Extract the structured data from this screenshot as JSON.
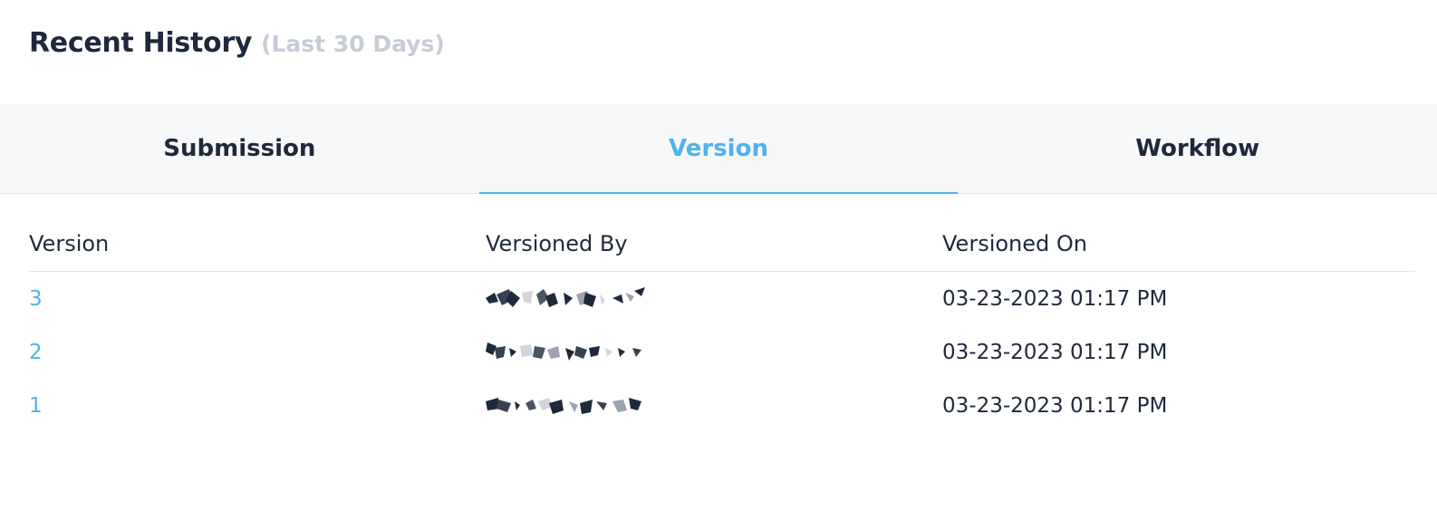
{
  "header": {
    "title": "Recent History",
    "subtitle": "(Last 30 Days)"
  },
  "tabs": [
    {
      "label": "Submission",
      "active": false
    },
    {
      "label": "Version",
      "active": true
    },
    {
      "label": "Workflow",
      "active": false
    }
  ],
  "table": {
    "columns": [
      "Version",
      "Versioned By",
      "Versioned On"
    ],
    "rows": [
      {
        "version": "3",
        "versioned_on": "03-23-2023 01:17 PM"
      },
      {
        "version": "2",
        "versioned_on": "03-23-2023 01:17 PM"
      },
      {
        "version": "1",
        "versioned_on": "03-23-2023 01:17 PM"
      }
    ]
  },
  "colors": {
    "accent": "#4fb3ec",
    "text": "#1e293b",
    "muted": "#c6ccd6",
    "tab_bg": "#f7f8fa"
  }
}
